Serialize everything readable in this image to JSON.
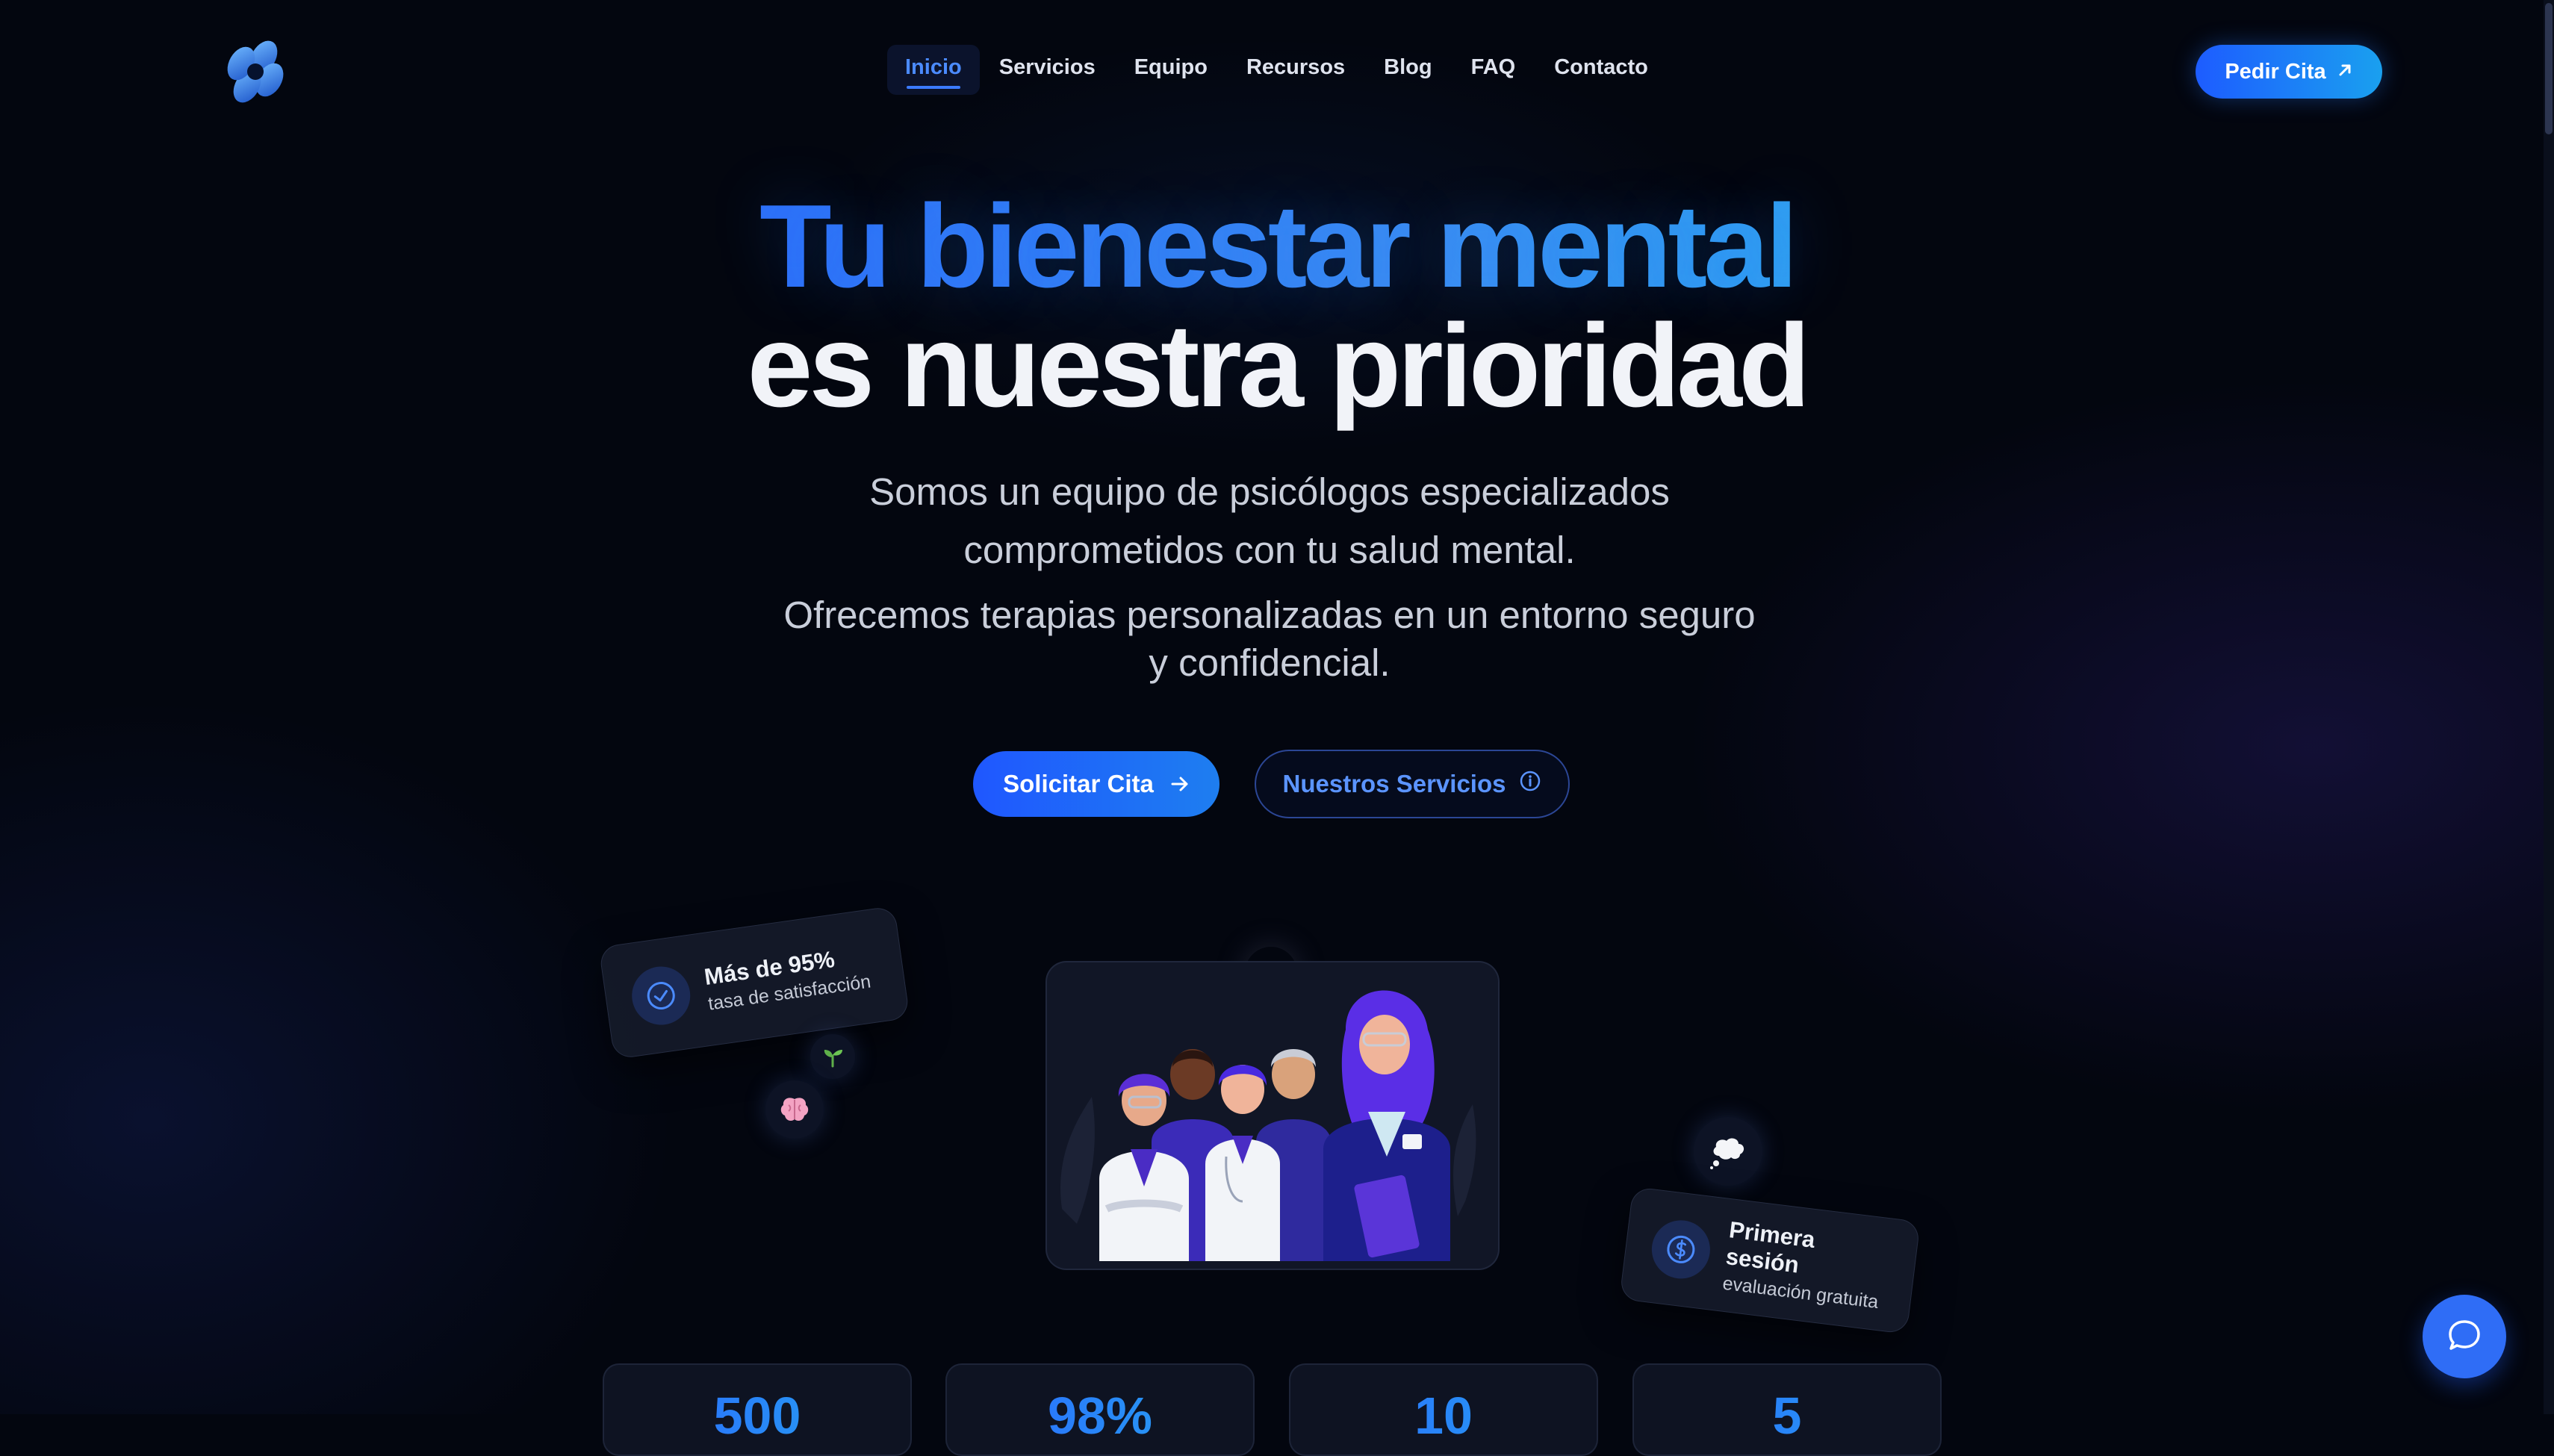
{
  "header": {
    "logo_icon": "flower-logo-icon",
    "nav": [
      {
        "label": "Inicio",
        "active": true
      },
      {
        "label": "Servicios"
      },
      {
        "label": "Equipo"
      },
      {
        "label": "Recursos"
      },
      {
        "label": "Blog"
      },
      {
        "label": "FAQ"
      },
      {
        "label": "Contacto"
      }
    ],
    "cta_label": "Pedir Cita",
    "cta_icon": "arrow-up-right-icon"
  },
  "hero": {
    "title_line1": "Tu bienestar mental",
    "title_line2": "es nuestra prioridad",
    "subtitle1": "Somos un equipo de psicólogos especializados comprometidos con tu salud mental.",
    "subtitle2": "Ofrecemos terapias personalizadas en un entorno seguro y confidencial.",
    "primary_button": "Solicitar Cita",
    "secondary_button": "Nuestros Servicios"
  },
  "cards": {
    "satisfaction": {
      "title": "Más de 95%",
      "subtitle": "tasa de satisfacción",
      "icon": "check-circle-icon"
    },
    "first_session": {
      "title": "Primera sesión",
      "subtitle": "evaluación gratuita",
      "icon": "dollar-circle-icon"
    }
  },
  "bubbles": [
    "heart-icon",
    "sprout-icon",
    "brain-icon",
    "thought-cloud-icon"
  ],
  "stats": [
    "500",
    "98%",
    "10",
    "5"
  ],
  "colors": {
    "background": "#03060f",
    "accent_blue": "#1f57ff",
    "accent_cyan": "#1cc4ee",
    "nav_active": "#4b8bff"
  }
}
